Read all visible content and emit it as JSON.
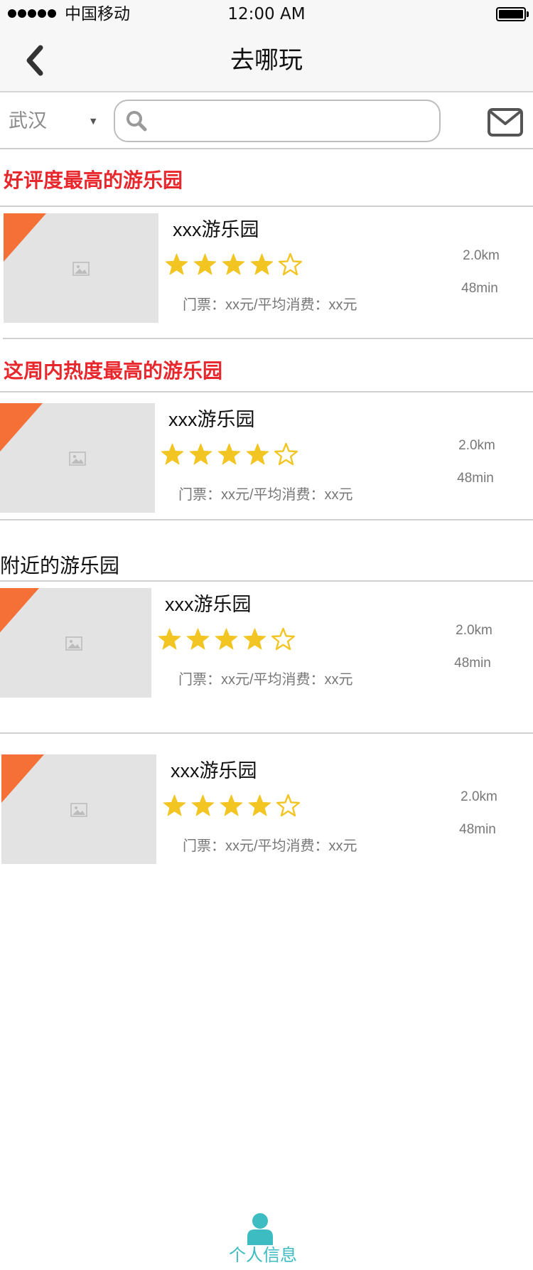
{
  "status_bar": {
    "carrier": "中国移动",
    "time": "12:00 AM"
  },
  "nav": {
    "title": "去哪玩",
    "back_icon": "chevron-left-icon"
  },
  "search": {
    "city": "武汉",
    "placeholder": "",
    "value": ""
  },
  "sections": [
    {
      "title": "好评度最高的游乐园",
      "items": [
        {
          "name": "xxx游乐园",
          "rating": 4,
          "max_rating": 5,
          "price": "门票：xx元/平均消费：xx元",
          "distance": "2.0km",
          "time": "48min"
        }
      ]
    },
    {
      "title": "这周内热度最高的游乐园",
      "items": [
        {
          "name": "xxx游乐园",
          "rating": 4,
          "max_rating": 5,
          "price": "门票：xx元/平均消费：xx元",
          "distance": "2.0km",
          "time": "48min"
        }
      ]
    },
    {
      "title": "附近的游乐园",
      "items": [
        {
          "name": "xxx游乐园",
          "rating": 4,
          "max_rating": 5,
          "price": "门票：xx元/平均消费：xx元",
          "distance": "2.0km",
          "time": "48min"
        },
        {
          "name": "xxx游乐园",
          "rating": 4,
          "max_rating": 5,
          "price": "门票：xx元/平均消费：xx元",
          "distance": "2.0km",
          "time": "48min"
        }
      ]
    }
  ],
  "tab_bar": {
    "profile_label": "个人信息"
  },
  "colors": {
    "accent_red": "#e8272d",
    "star": "#f2c523",
    "corner": "#f47036",
    "tab": "#3dbcc2"
  }
}
